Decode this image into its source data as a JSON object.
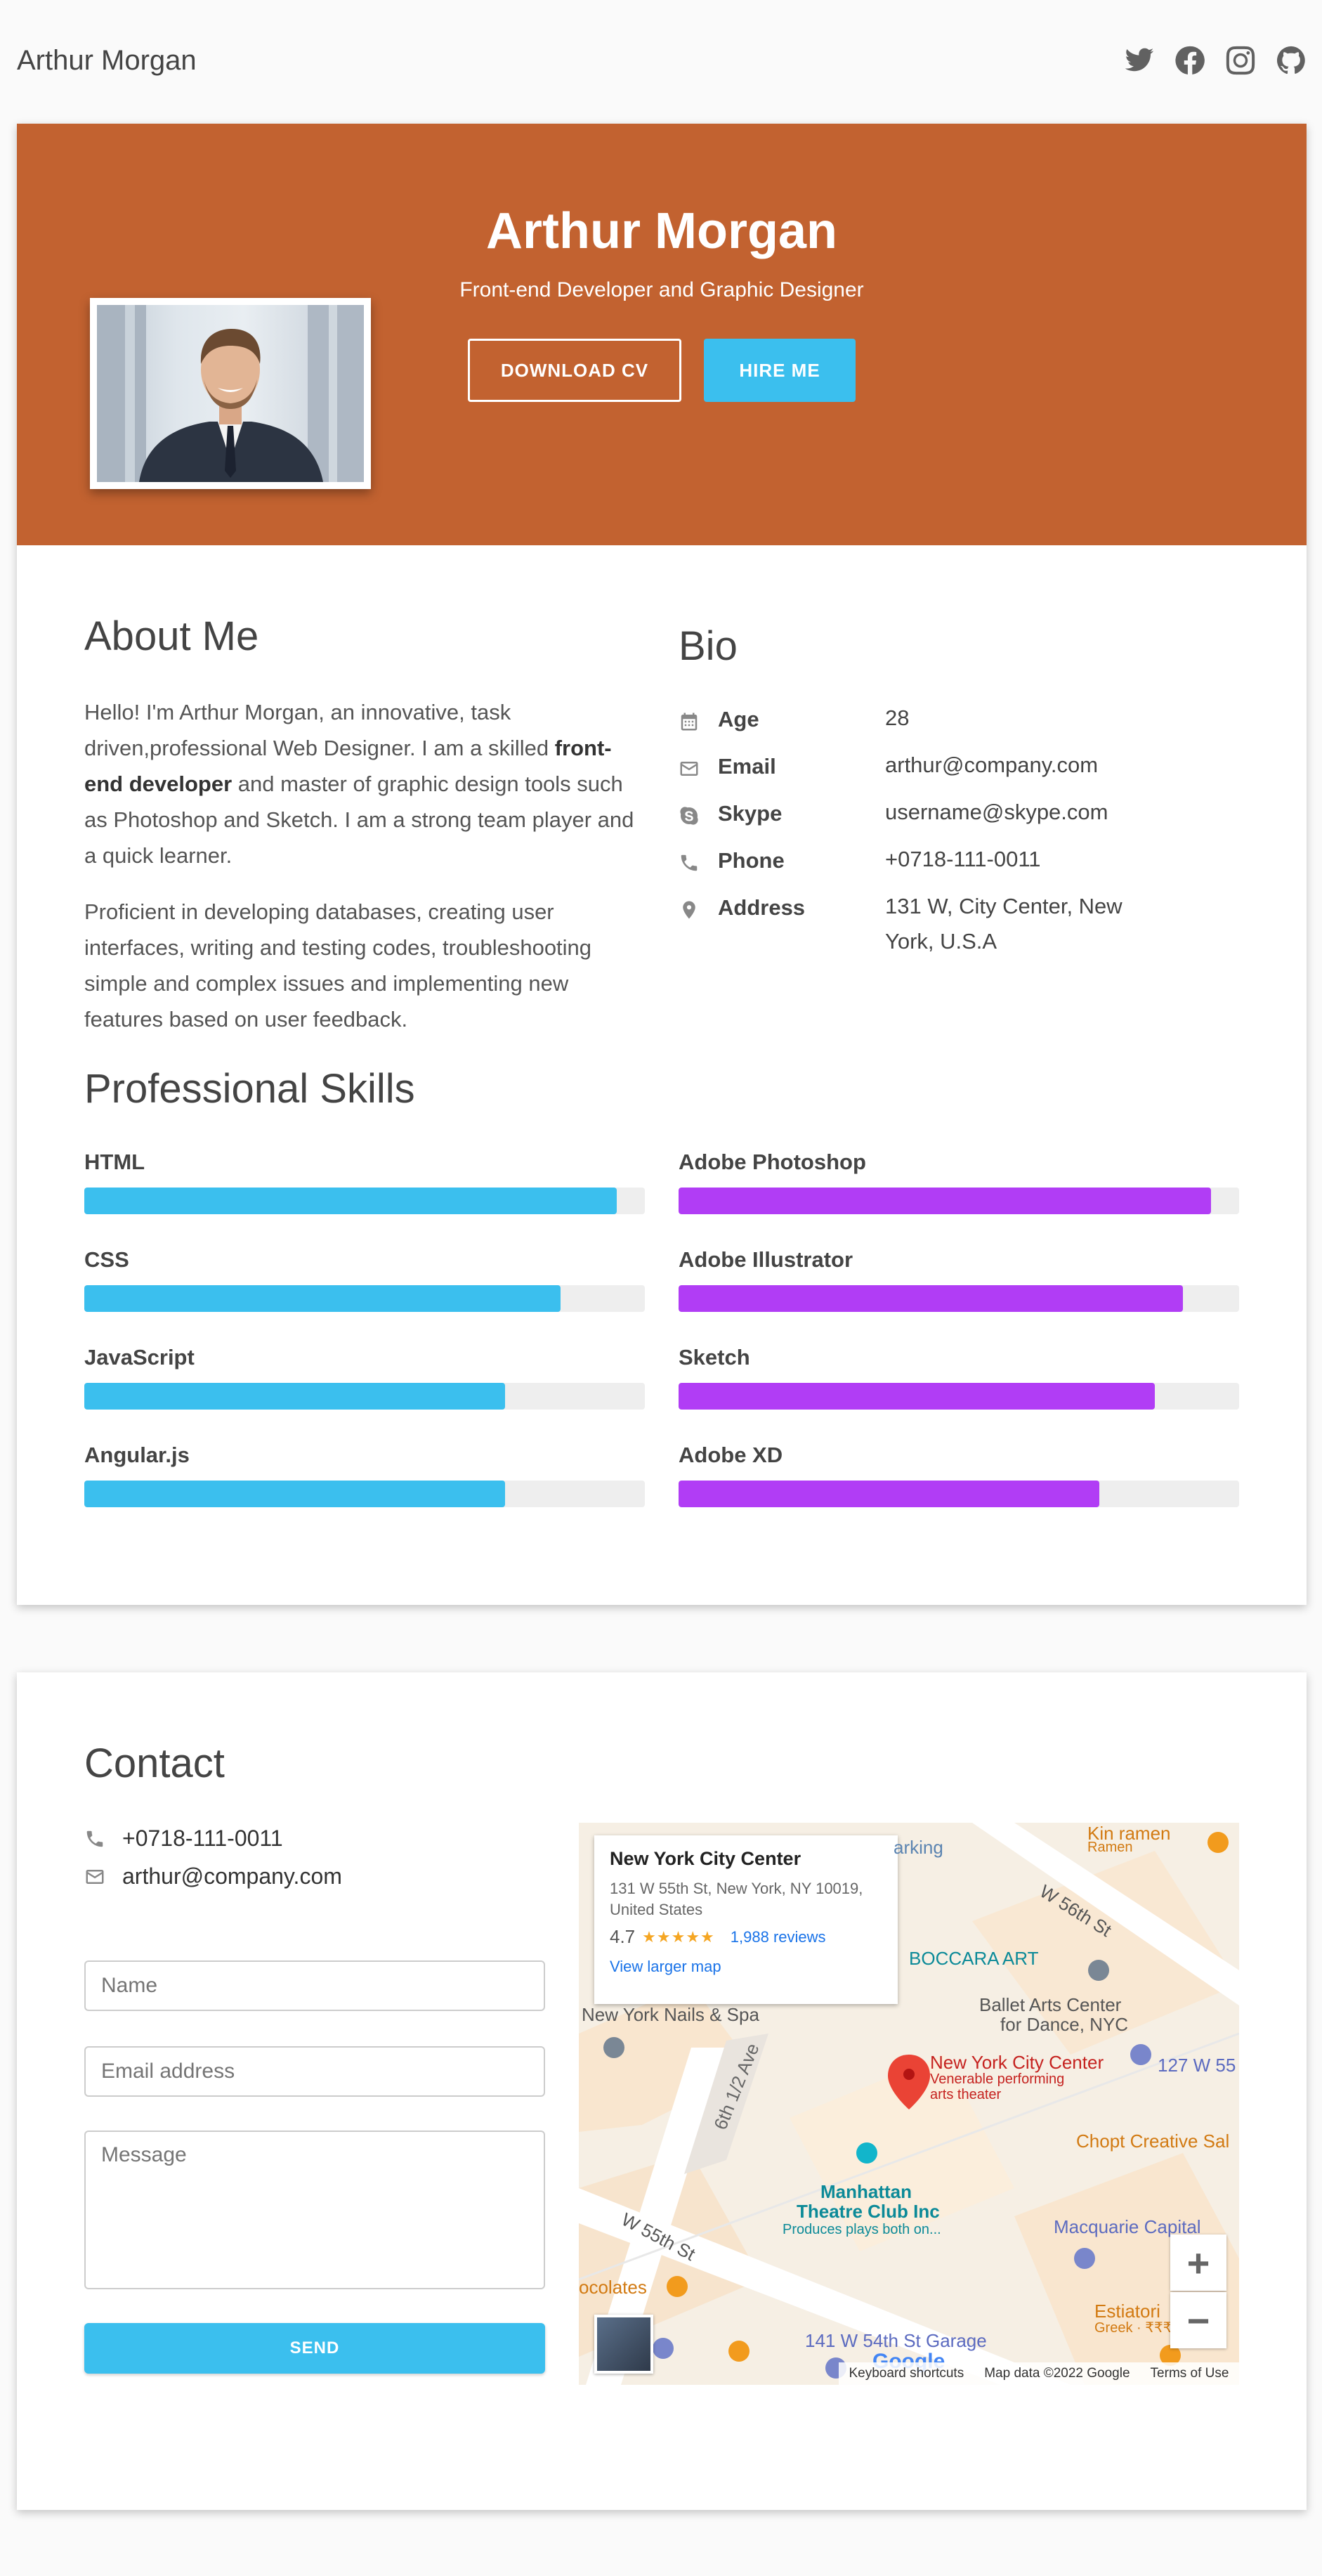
{
  "header": {
    "brand": "Arthur Morgan",
    "socials": [
      "twitter-icon",
      "facebook-icon",
      "instagram-icon",
      "github-icon"
    ]
  },
  "hero": {
    "name": "Arthur Morgan",
    "title": "Front-end Developer and Graphic Designer",
    "download_cv": "DOWNLOAD CV",
    "hire_me": "HIRE ME",
    "background_color": "#c26230"
  },
  "about": {
    "heading": "About Me",
    "p1_before": "Hello! I'm Arthur Morgan, an innovative, task driven,professional Web Designer. I am a skilled ",
    "p1_bold": "front-end developer",
    "p1_after": " and master of graphic design tools such as Photoshop and Sketch. I am a strong team player and a quick learner.",
    "p2": "Proficient in developing databases, creating user interfaces, writing and testing codes, troubleshooting simple and complex issues and implementing new features based on user feedback."
  },
  "bio": {
    "heading": "Bio",
    "rows": [
      {
        "label": "Age",
        "value": "28",
        "icon": "calendar-icon"
      },
      {
        "label": "Email",
        "value": "arthur@company.com",
        "icon": "envelope-icon"
      },
      {
        "label": "Skype",
        "value": "username@skype.com",
        "icon": "skype-icon"
      },
      {
        "label": "Phone",
        "value": "+0718-111-0011",
        "icon": "phone-icon"
      },
      {
        "label": "Address",
        "value": "131 W, City Center, New York, U.S.A",
        "icon": "map-marker-icon"
      }
    ]
  },
  "skills": {
    "heading": "Professional Skills",
    "left_color": "#3bbfee",
    "right_color": "#b13df5",
    "left": [
      {
        "name": "HTML",
        "level": 95
      },
      {
        "name": "CSS",
        "level": 85
      },
      {
        "name": "JavaScript",
        "level": 75
      },
      {
        "name": "Angular.js",
        "level": 75
      }
    ],
    "right": [
      {
        "name": "Adobe Photoshop",
        "level": 95
      },
      {
        "name": "Adobe Illustrator",
        "level": 90
      },
      {
        "name": "Sketch",
        "level": 85
      },
      {
        "name": "Adobe XD",
        "level": 75
      }
    ]
  },
  "contact": {
    "heading": "Contact",
    "phone": "+0718-111-0011",
    "email": "arthur@company.com",
    "name_placeholder": "Name",
    "email_placeholder": "Email address",
    "message_placeholder": "Message",
    "send": "SEND"
  },
  "map": {
    "place_title": "New York City Center",
    "place_address": "131 W 55th St, New York, NY 10019, United States",
    "rating": "4.7",
    "stars": "★★★★★",
    "reviews": "1,988 reviews",
    "larger_map": "View larger map",
    "labels": {
      "arking": "arking",
      "w56": "W 56th St",
      "boccara": "BOCCARA ART",
      "ballet1": "Ballet Arts Center",
      "ballet2": "for Dance, NYC",
      "nails": "New York Nails & Spa",
      "ave": "6th 1/2 Ave",
      "nycc": "New York City Center",
      "venerable1": "Venerable performing",
      "venerable2": "arts theater",
      "w127": "127 W 55",
      "chopt": "Chopt Creative Sal",
      "manhattan1": "Manhattan",
      "manhattan2": "Theatre Club Inc",
      "produces": "Produces plays both on...",
      "w55": "W 55th St",
      "macquarie": "Macquarie Capital",
      "chocolates": "ocolates",
      "estiatorio": "Estiatori",
      "greek": "Greek · ₹₹₹",
      "garage": "141 W 54th St Garage",
      "kinramen": "Kin ramen",
      "ramen": "Ramen"
    },
    "zoom_in": "+",
    "zoom_out": "−",
    "google": "Google",
    "footer": [
      "Keyboard shortcuts",
      "Map data ©2022 Google",
      "Terms of Use"
    ]
  }
}
